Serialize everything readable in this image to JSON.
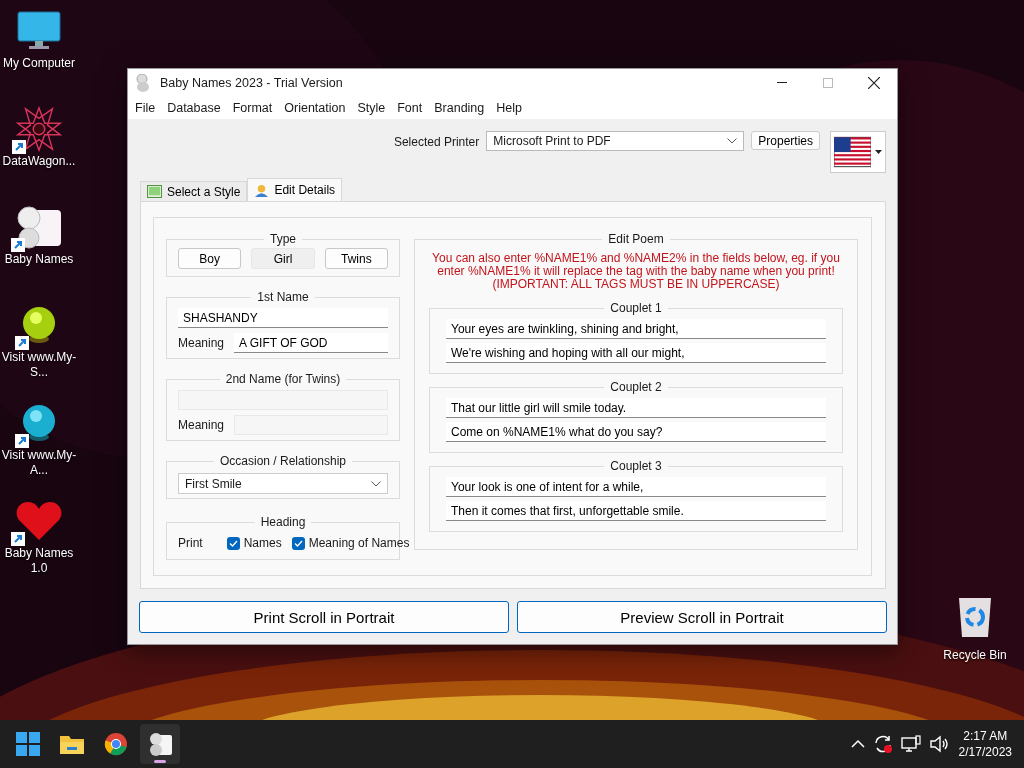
{
  "desktop_icons": [
    {
      "kind": "monitor",
      "label": "My Computer",
      "shortcut": false
    },
    {
      "kind": "star",
      "label": "DataWagon...",
      "shortcut": true
    },
    {
      "kind": "baby",
      "label": "Baby Names",
      "shortcut": true
    },
    {
      "kind": "green-ball",
      "label": "Visit www.My-S...",
      "shortcut": true
    },
    {
      "kind": "blue-ball",
      "label": "Visit www.My-A...",
      "shortcut": true
    },
    {
      "kind": "heart",
      "label": "Baby Names 1.0",
      "shortcut": true
    }
  ],
  "recycle_bin": {
    "label": "Recycle Bin"
  },
  "window": {
    "title": "Baby Names 2023 - Trial Version",
    "menu": [
      "File",
      "Database",
      "Format",
      "Orientation",
      "Style",
      "Font",
      "Branding",
      "Help"
    ],
    "printer": {
      "label": "Selected Printer",
      "value": "Microsoft Print to PDF",
      "properties_button": "Properties"
    },
    "tabs": [
      {
        "label": "Select a Style",
        "kind": "picture-tab",
        "selected": false
      },
      {
        "label": "Edit Details",
        "kind": "person-tab",
        "selected": true
      }
    ],
    "type": {
      "title": "Type",
      "buttons": [
        {
          "label": "Boy",
          "selected": false
        },
        {
          "label": "Girl",
          "selected": true
        },
        {
          "label": "Twins",
          "selected": false
        }
      ]
    },
    "first_name": {
      "title": "1st Name",
      "name": "SHASHANDY",
      "meaning_label": "Meaning",
      "meaning": "A GIFT OF GOD",
      "disabled": false
    },
    "second_name": {
      "title": "2nd Name (for Twins)",
      "meaning_label": "Meaning",
      "disabled": true
    },
    "occasion": {
      "title": "Occasion / Relationship",
      "value": "First Smile"
    },
    "heading": {
      "title": "Heading",
      "print_label": "Print",
      "checkboxes": [
        {
          "label": "Names",
          "checked": true
        },
        {
          "label": "Meaning of Names",
          "checked": true
        }
      ]
    },
    "poem": {
      "title": "Edit Poem",
      "note": "You can also enter %NAME1% and %NAME2% in the fields below, eg. if you enter %NAME1% it will replace the tag with the baby name when you print! (IMPORTANT: ALL TAGS MUST BE IN UPPERCASE)",
      "couplets": [
        {
          "title": "Couplet 1",
          "lines": [
            "Your eyes are twinkling, shining and bright,",
            "We're wishing and hoping with all our might,"
          ]
        },
        {
          "title": "Couplet 2",
          "lines": [
            "That our little girl will smile today.",
            "Come on %NAME1% what do you say?"
          ]
        },
        {
          "title": "Couplet 3",
          "lines": [
            "Your look is one of intent for a while,",
            "Then it comes that first, unforgettable smile."
          ]
        }
      ]
    },
    "buttons": [
      "Print Scroll in Portrait",
      "Preview Scroll in Portrait"
    ]
  },
  "taskbar": {
    "apps": [
      {
        "kind": "start",
        "active": false
      },
      {
        "kind": "folder",
        "active": false
      },
      {
        "kind": "browser",
        "active": false
      },
      {
        "kind": "baby",
        "active": true
      }
    ],
    "tray": [
      {
        "kind": "chevron"
      },
      {
        "kind": "sync"
      },
      {
        "kind": "network"
      },
      {
        "kind": "volume"
      }
    ],
    "time": "2:17 AM",
    "date": "2/17/2023"
  }
}
